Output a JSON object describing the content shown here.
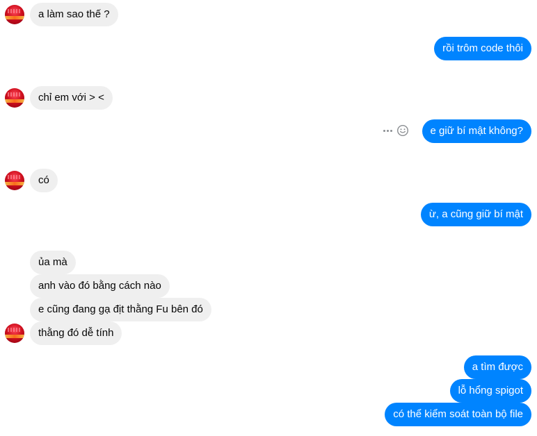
{
  "conversation": {
    "messages": [
      {
        "side": "in",
        "text": "a làm sao thế ?"
      },
      {
        "side": "out",
        "text": "rồi trôm code thôi"
      },
      {
        "side": "in",
        "text": "chỉ em với > <"
      },
      {
        "side": "out",
        "text": "e giữ bí mật không?"
      },
      {
        "side": "in",
        "text": "có"
      },
      {
        "side": "out",
        "text": "ừ, a cũng giữ bí mật"
      },
      {
        "side": "in",
        "text": "ủa mà"
      },
      {
        "side": "in",
        "text": "anh vào đó bằng cách nào"
      },
      {
        "side": "in",
        "text": "e cũng đang gạ địt thằng Fu bên đó"
      },
      {
        "side": "in",
        "text": "thằng đó dễ tính"
      },
      {
        "side": "out",
        "text": "a tìm được"
      },
      {
        "side": "out",
        "text": "lỗ hổng spigot"
      },
      {
        "side": "out",
        "text": "có thể kiểm soát toàn bộ file"
      }
    ]
  },
  "message_actions": {
    "icons": [
      "more-icon",
      "emoji-react-icon"
    ]
  },
  "colors": {
    "outgoing_bubble": "#0084ff",
    "incoming_bubble": "#efefef",
    "avatar": "#d0101f"
  }
}
